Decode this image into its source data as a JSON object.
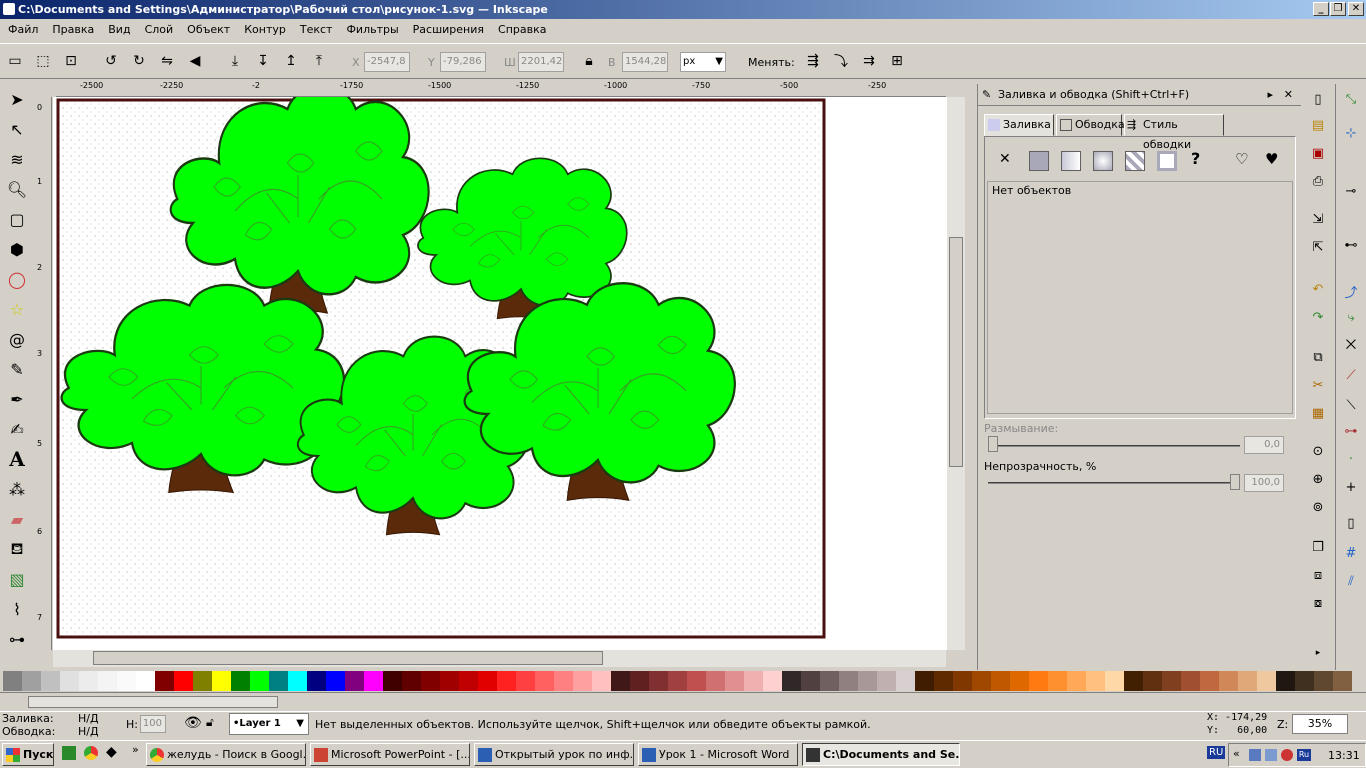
{
  "window": {
    "title": "C:\\Documents and Settings\\Администратор\\Рабочий стол\\рисунок-1.svg — Inkscape",
    "min_btn": "_",
    "max_btn": "❐",
    "close_btn": "✕"
  },
  "menu": [
    "Файл",
    "Правка",
    "Вид",
    "Слой",
    "Объект",
    "Контур",
    "Текст",
    "Фильтры",
    "Расширения",
    "Справка"
  ],
  "toolbar": {
    "x_label": "X",
    "x_value": "-2547,8",
    "y_label": "Y",
    "y_value": "-79,286",
    "w_label": "Ш",
    "w_value": "2201,42",
    "h_label": "В",
    "h_value": "1544,28",
    "unit": "px",
    "change_label": "Менять:"
  },
  "ruler": {
    "h_ticks": [
      "-2500",
      "-2250",
      "-2",
      "-1750",
      "-1500",
      "-1250",
      "-1000",
      "-750",
      "-500",
      "-250"
    ],
    "v_ticks": [
      "0",
      "1",
      "2",
      "3",
      "5",
      "6",
      "7"
    ]
  },
  "panel": {
    "title": "Заливка и обводка (Shift+Ctrl+F)",
    "tabs": [
      "Заливка",
      "Обводка",
      "Стиль обводки"
    ],
    "no_objects": "Нет объектов",
    "blur_label": "Размывание:",
    "blur_value": "0,0",
    "blur_level": 0,
    "opacity_label": "Непрозрачность, %",
    "opacity_value": "100,0",
    "opacity_level": 100
  },
  "palette": [
    "#808080",
    "#a0a0a0",
    "#c0c0c0",
    "#e0e0e0",
    "#ececec",
    "#f4f4f4",
    "#fafafa",
    "#ffffff",
    "#800000",
    "#ff0000",
    "#808000",
    "#ffff00",
    "#008000",
    "#00ff00",
    "#008080",
    "#00ffff",
    "#000080",
    "#0000ff",
    "#800080",
    "#ff00ff",
    "#400000",
    "#600000",
    "#800000",
    "#a00000",
    "#c00000",
    "#e00000",
    "#ff2020",
    "#ff4040",
    "#ff6060",
    "#ff8080",
    "#ffa0a0",
    "#ffc0c0",
    "#401818",
    "#602020",
    "#803030",
    "#a04040",
    "#c05050",
    "#d07070",
    "#e09090",
    "#f0b0b0",
    "#ffd0d0",
    "#302828",
    "#504040",
    "#706060",
    "#908080",
    "#a89898",
    "#c0b0b0",
    "#d8d0d0",
    "#401c00",
    "#602a00",
    "#803800",
    "#a04800",
    "#c05800",
    "#e06800",
    "#ff7a10",
    "#ff9030",
    "#ffa858",
    "#ffc080",
    "#ffd8a8",
    "#402000",
    "#603010",
    "#804020",
    "#a05030",
    "#c06840",
    "#d08858",
    "#e0a878",
    "#f0c8a0",
    "#201810",
    "#403020",
    "#604830",
    "#806040"
  ],
  "status": {
    "fill_label": "Заливка:",
    "fill_value": "Н/Д",
    "stroke_label": "Обводка:",
    "stroke_value": "Н/Д",
    "h_label": "H:",
    "h_value": "100",
    "layer": "•Layer 1",
    "message": "Нет выделенных объектов. Используйте щелчок, Shift+щелчок или обведите объекты рамкой.",
    "x_coord": "X: -174,29",
    "y_coord": "Y:   60,00",
    "zoom_label": "Z:",
    "zoom": "35%"
  },
  "taskbar": {
    "start": "Пуск",
    "tasks": [
      "желудь - Поиск в Googl...",
      "Microsoft PowerPoint - [...",
      "Открытый урок по инф...",
      "Урок 1 - Microsoft Word",
      "C:\\Documents and Se..."
    ],
    "lang": "RU",
    "clock": "13:31"
  },
  "colors": {
    "leaf": "#00ff00",
    "trunk": "#5a2a0a",
    "page_border": "#4a1010",
    "title_start": "#0a246a"
  }
}
